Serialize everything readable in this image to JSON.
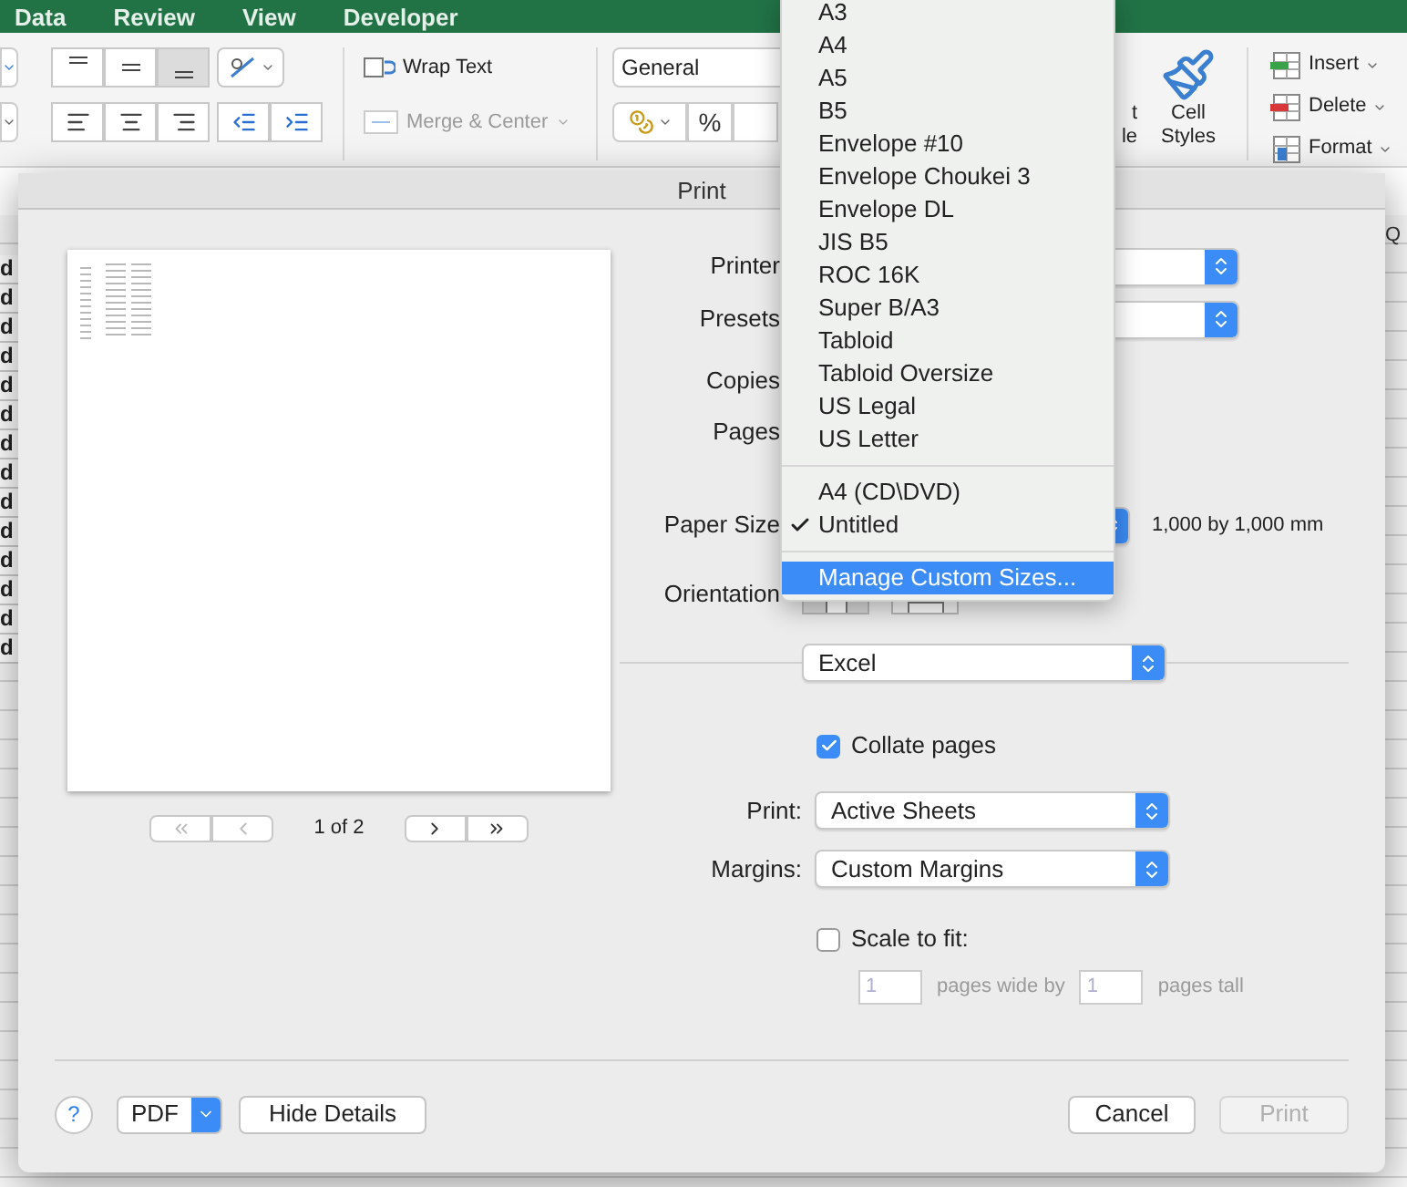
{
  "ribbon": {
    "tabs": [
      {
        "label": "Data"
      },
      {
        "label": "Review"
      },
      {
        "label": "View"
      },
      {
        "label": "Developer"
      }
    ],
    "vertical_align": [
      {
        "selected": false
      },
      {
        "selected": false
      },
      {
        "selected": true
      }
    ],
    "wrap_text": {
      "label": "Wrap Text"
    },
    "merge_center": {
      "label": "Merge & Center",
      "disabled": true
    },
    "number_format": {
      "value": "General"
    },
    "percent": "%",
    "format_table": {
      "lines": [
        "t",
        "le"
      ]
    },
    "cell_styles": {
      "lines": [
        "Cell",
        "Styles"
      ]
    },
    "cells_group": [
      {
        "kind": "insert",
        "label": "Insert"
      },
      {
        "kind": "delete",
        "label": "Delete"
      },
      {
        "kind": "format",
        "label": "Format"
      }
    ]
  },
  "sheet": {
    "column_header": "Q",
    "cells": [
      "d",
      "d",
      "d",
      "d",
      "d",
      "d",
      "d",
      "d",
      "d",
      "d",
      "d",
      "d",
      "d",
      "d"
    ]
  },
  "dialog": {
    "title": "Print",
    "preview": {
      "page_indicator": "1 of 2"
    },
    "fields": {
      "printer": {
        "label": "Printer"
      },
      "presets": {
        "label": "Presets"
      },
      "copies": {
        "label": "Copies"
      },
      "pages": {
        "label": "Pages"
      },
      "paper_size": {
        "label": "Paper Size",
        "detail": "1,000 by 1,000 mm"
      },
      "orientation": {
        "label": "Orientation",
        "options": [
          {
            "selected": true
          },
          {
            "selected": false
          }
        ]
      }
    },
    "section_popup": {
      "value": "Excel"
    },
    "collate": {
      "label": "Collate pages",
      "checked": true
    },
    "print_what": {
      "label": "Print:",
      "value": "Active Sheets"
    },
    "margins": {
      "label": "Margins:",
      "value": "Custom Margins"
    },
    "scale_to_fit": {
      "label": "Scale to fit:",
      "checked": false,
      "wide": "1",
      "wide_label": "pages wide by",
      "tall": "1",
      "tall_label": "pages tall"
    },
    "footer": {
      "help": "?",
      "pdf": "PDF",
      "hide_details": "Hide Details",
      "cancel": "Cancel",
      "print": {
        "label": "Print",
        "disabled": true
      }
    }
  },
  "paper_menu": {
    "sections": [
      [
        {
          "label": "A3",
          "checked": false,
          "selected": false
        },
        {
          "label": "A4",
          "checked": false,
          "selected": false
        },
        {
          "label": "A5",
          "checked": false,
          "selected": false
        },
        {
          "label": "B5",
          "checked": false,
          "selected": false
        },
        {
          "label": "Envelope #10",
          "checked": false,
          "selected": false
        },
        {
          "label": "Envelope Choukei 3",
          "checked": false,
          "selected": false
        },
        {
          "label": "Envelope DL",
          "checked": false,
          "selected": false
        },
        {
          "label": "JIS B5",
          "checked": false,
          "selected": false
        },
        {
          "label": "ROC 16K",
          "checked": false,
          "selected": false
        },
        {
          "label": "Super B/A3",
          "checked": false,
          "selected": false
        },
        {
          "label": "Tabloid",
          "checked": false,
          "selected": false
        },
        {
          "label": "Tabloid Oversize",
          "checked": false,
          "selected": false
        },
        {
          "label": "US Legal",
          "checked": false,
          "selected": false
        },
        {
          "label": "US Letter",
          "checked": false,
          "selected": false
        }
      ],
      [
        {
          "label": "A4 (CD\\DVD)",
          "checked": false,
          "selected": false
        },
        {
          "label": "Untitled",
          "checked": true,
          "selected": false
        }
      ],
      [
        {
          "label": "Manage Custom Sizes...",
          "checked": false,
          "selected": true
        }
      ]
    ]
  }
}
